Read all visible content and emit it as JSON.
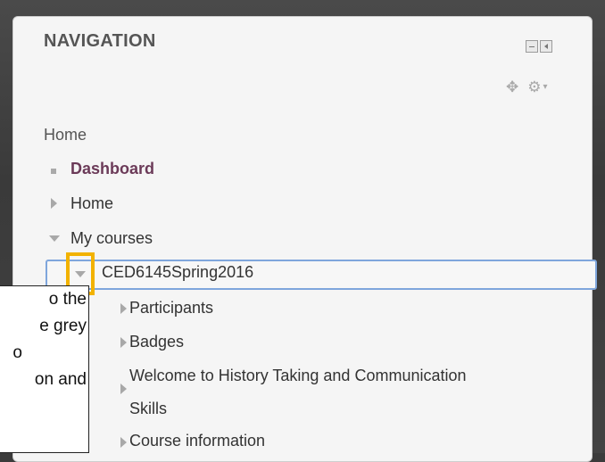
{
  "navigation": {
    "title": "NAVIGATION",
    "home_root": "Home",
    "items": {
      "dashboard": "Dashboard",
      "home": "Home",
      "my_courses": "My courses",
      "course": "CED6145Spring2016",
      "participants": "Participants",
      "badges": "Badges",
      "welcome_line1": "Welcome to History Taking and Communication",
      "welcome_line2": "Skills",
      "course_information": "Course information"
    }
  },
  "callout": {
    "lines": [
      "o the",
      "e grey",
      "o",
      "on and"
    ]
  },
  "icons": {
    "minimize": "minimize-icon",
    "dock": "dock-icon",
    "move": "move-icon",
    "gear": "gear-icon"
  },
  "colors": {
    "highlight": "#f2b200",
    "selection_border": "#7fa6dc",
    "dashboard_text": "#6b3a58"
  }
}
